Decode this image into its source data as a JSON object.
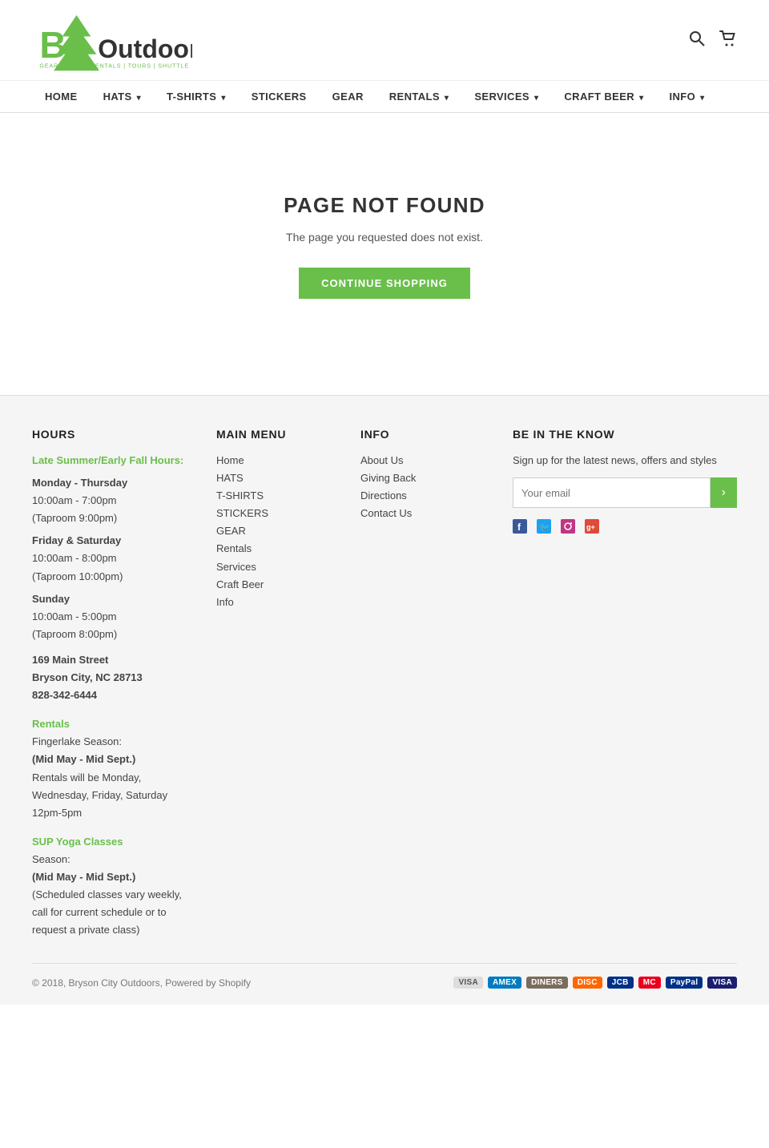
{
  "header": {
    "logo_text": "BCOutdoors",
    "logo_tagline": "GEAR | BEER | RENTALS | TOURS | SHUTTLE",
    "search_label": "Search",
    "cart_label": "Cart"
  },
  "nav": {
    "items": [
      {
        "label": "HOME",
        "has_dropdown": false
      },
      {
        "label": "HATS",
        "has_dropdown": true
      },
      {
        "label": "T-SHIRTS",
        "has_dropdown": true
      },
      {
        "label": "STICKERS",
        "has_dropdown": false
      },
      {
        "label": "GEAR",
        "has_dropdown": false
      },
      {
        "label": "RENTALS",
        "has_dropdown": true
      },
      {
        "label": "SERVICES",
        "has_dropdown": true
      },
      {
        "label": "CRAFT BEER",
        "has_dropdown": true
      },
      {
        "label": "INFO",
        "has_dropdown": true
      }
    ]
  },
  "main": {
    "title": "PAGE NOT FOUND",
    "message": "The page you requested does not exist.",
    "cta_label": "CONTINUE SHOPPING"
  },
  "footer": {
    "hours_heading": "HOURS",
    "hours_season_label": "Late Summer/Early Fall Hours:",
    "hours_weekday_label": "Monday - Thursday",
    "hours_weekday_time": "10:00am - 7:00pm",
    "hours_weekday_taproom": "(Taproom 9:00pm)",
    "hours_fri_sat_label": "Friday & Saturday",
    "hours_fri_sat_time": "10:00am - 8:00pm",
    "hours_fri_sat_taproom": "(Taproom 10:00pm)",
    "hours_sun_label": "Sunday",
    "hours_sun_time": "10:00am - 5:00pm",
    "hours_sun_taproom": "(Taproom 8:00pm)",
    "address_street": "169 Main Street",
    "address_city": "Bryson City, NC 28713",
    "address_phone": "828-342-6444",
    "rentals_heading": "Rentals",
    "rentals_season": "Fingerlake Season:",
    "rentals_season_dates": "(Mid May - Mid Sept.)",
    "rentals_schedule": "Rentals will be Monday, Wednesday, Friday, Saturday",
    "rentals_hours": "12pm-5pm",
    "sup_heading": "SUP Yoga Classes",
    "sup_season": "Season:",
    "sup_season_dates": "(Mid May - Mid Sept.)",
    "sup_desc": "(Scheduled classes vary weekly, call for current schedule or to request a private class)",
    "main_menu_heading": "MAIN MENU",
    "main_menu_items": [
      {
        "label": "Home"
      },
      {
        "label": "HATS"
      },
      {
        "label": "T-SHIRTS"
      },
      {
        "label": "STICKERS"
      },
      {
        "label": "GEAR"
      },
      {
        "label": "Rentals"
      },
      {
        "label": "Services"
      },
      {
        "label": "Craft Beer"
      },
      {
        "label": "Info"
      }
    ],
    "info_heading": "INFO",
    "info_items": [
      {
        "label": "About Us"
      },
      {
        "label": "Giving Back"
      },
      {
        "label": "Directions"
      },
      {
        "label": "Contact Us"
      }
    ],
    "newsletter_heading": "BE IN THE KNOW",
    "newsletter_desc": "Sign up for the latest news, offers and styles",
    "newsletter_placeholder": "Your email",
    "newsletter_btn": "›",
    "social_items": [
      {
        "label": "Facebook",
        "icon": "f"
      },
      {
        "label": "Twitter",
        "icon": "t"
      },
      {
        "label": "Instagram",
        "icon": "i"
      },
      {
        "label": "Google Plus",
        "icon": "g+"
      }
    ],
    "copyright": "© 2018, Bryson City Outdoors, Powered by Shopify",
    "payment_methods": [
      "VISA",
      "MC",
      "AMEX",
      "DINERS",
      "DISC",
      "JCB",
      "MASTER",
      "PayPal",
      "VISA"
    ]
  }
}
